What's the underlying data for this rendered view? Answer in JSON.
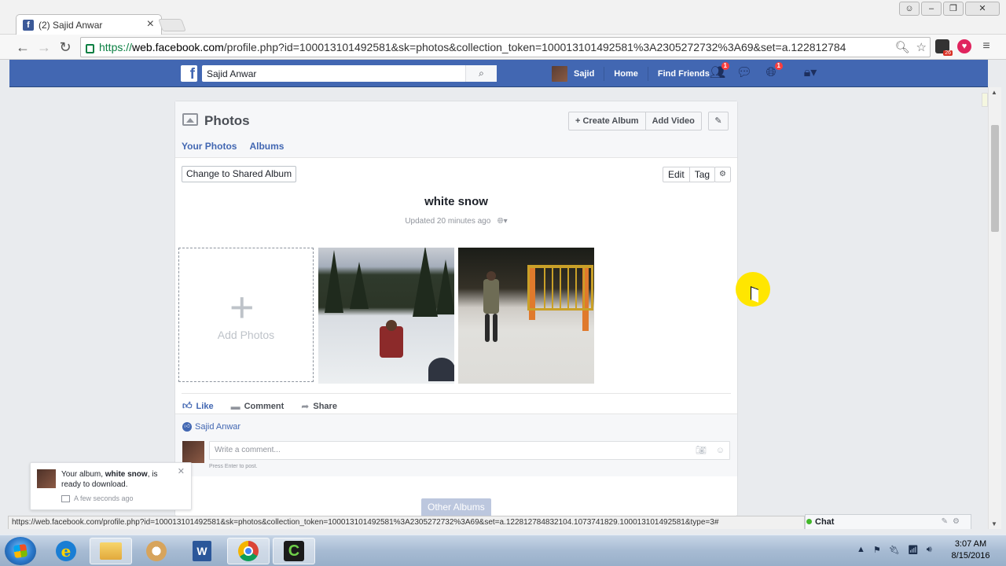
{
  "browser": {
    "tab_title": "(2) Sajid Anwar",
    "url_scheme": "https://",
    "url_host": "web.facebook.com",
    "url_path": "/profile.php?id=100013101492581&sk=photos&collection_token=100013101492581%3A2305272732%3A69&set=a.122812784"
  },
  "fb_header": {
    "search_value": "Sajid Anwar",
    "user_name": "Sajid",
    "home_label": "Home",
    "find_friends_label": "Find Friends",
    "friend_badge": "1",
    "globe_badge": "1"
  },
  "photos": {
    "title": "Photos",
    "create_album_label": "+ Create Album",
    "add_video_label": "Add Video",
    "tabs": [
      "Your Photos",
      "Albums"
    ],
    "change_shared_label": "Change to Shared Album",
    "edit_label": "Edit",
    "tag_label": "Tag"
  },
  "album": {
    "name": "white snow",
    "updated": "Updated 20 minutes ago",
    "add_photos_label": "Add Photos"
  },
  "actions": {
    "like": "Like",
    "comment": "Comment",
    "share": "Share"
  },
  "comments": {
    "liker_name": "Sajid Anwar",
    "placeholder": "Write a comment...",
    "hint": "Press Enter to post."
  },
  "other_albums_label": "Other Albums",
  "notification": {
    "text_prefix": "Your album, ",
    "album_name": "white snow",
    "text_suffix": ", is ready to download.",
    "time": "A few seconds ago"
  },
  "status_url": "https://web.facebook.com/profile.php?id=100013101492581&sk=photos&collection_token=100013101492581%3A2305272732%3A69&set=a.122812784832104.1073741829.100013101492581&type=3#",
  "chat_label": "Chat",
  "taskbar": {
    "time": "3:07 AM",
    "date": "8/15/2016"
  }
}
